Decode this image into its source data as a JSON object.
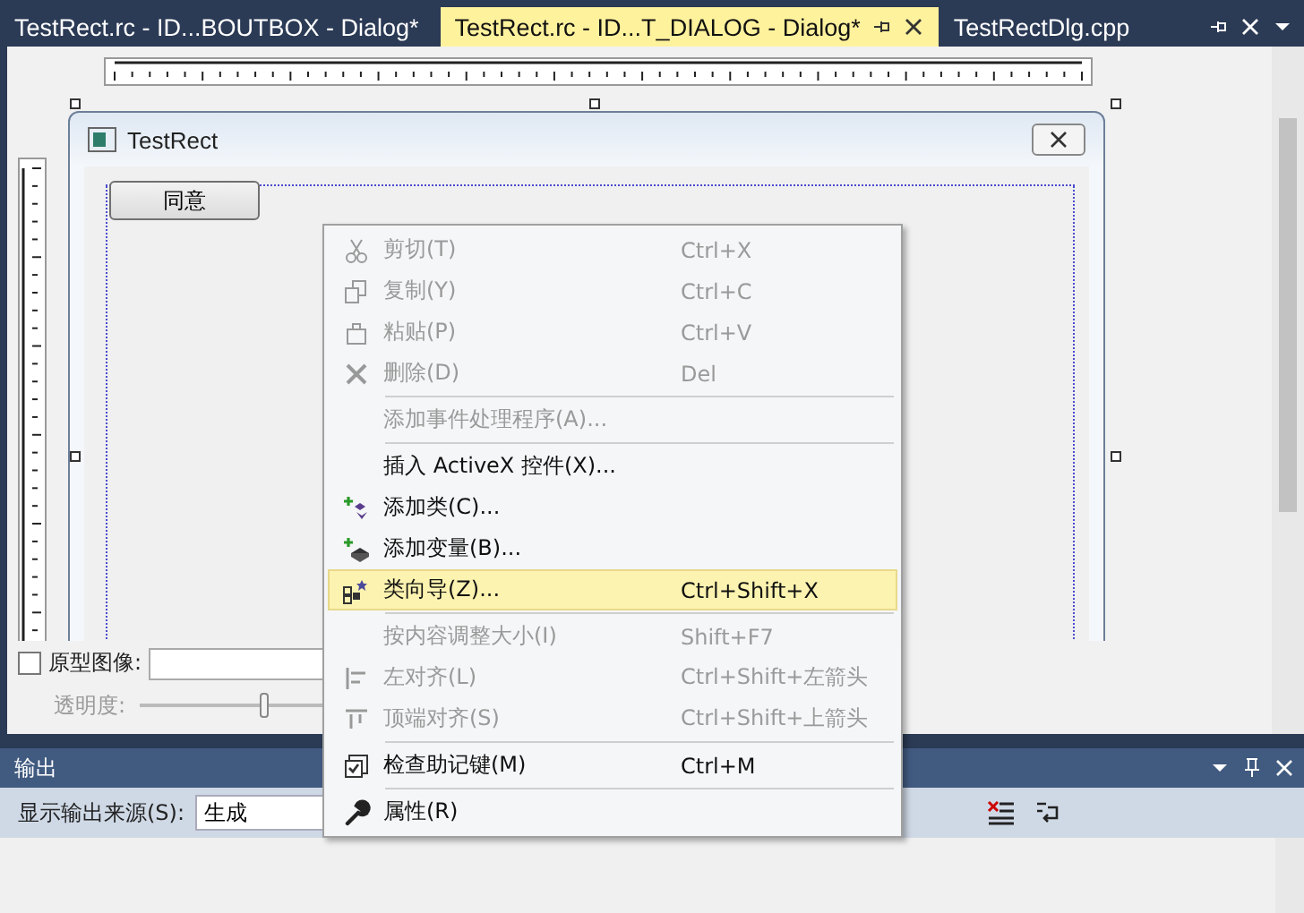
{
  "tabs": [
    {
      "label": "TestRect.rc - ID...BOUTBOX - Dialog*",
      "selected": false
    },
    {
      "label": "TestRect.rc - ID...T_DIALOG - Dialog*",
      "selected": true
    },
    {
      "label": "TestRectDlg.cpp",
      "selected": false
    }
  ],
  "dialog": {
    "title": "TestRect",
    "button": "同意"
  },
  "designer_options": {
    "prototype_checkbox": {
      "label": "原型图像:",
      "checked": false
    },
    "opacity": {
      "label": "透明度:",
      "level": 0.5
    }
  },
  "context_menu": [
    {
      "kind": "item",
      "label": "剪切(T)",
      "shortcut": "Ctrl+X",
      "disabled": true,
      "selected": false
    },
    {
      "kind": "item",
      "label": "复制(Y)",
      "shortcut": "Ctrl+C",
      "disabled": true,
      "selected": false
    },
    {
      "kind": "item",
      "label": "粘贴(P)",
      "shortcut": "Ctrl+V",
      "disabled": true,
      "selected": false
    },
    {
      "kind": "item",
      "label": "删除(D)",
      "shortcut": "Del",
      "disabled": true,
      "selected": false
    },
    {
      "kind": "separator"
    },
    {
      "kind": "item",
      "label": "添加事件处理程序(A)...",
      "disabled": true,
      "selected": false
    },
    {
      "kind": "separator"
    },
    {
      "kind": "item",
      "label": "插入 ActiveX 控件(X)...",
      "disabled": false,
      "selected": false
    },
    {
      "kind": "item",
      "label": "添加类(C)...",
      "disabled": false,
      "selected": false
    },
    {
      "kind": "item",
      "label": "添加变量(B)...",
      "disabled": false,
      "selected": false
    },
    {
      "kind": "item",
      "label": "类向导(Z)...",
      "shortcut": "Ctrl+Shift+X",
      "disabled": false,
      "selected": true
    },
    {
      "kind": "separator"
    },
    {
      "kind": "item",
      "label": "按内容调整大小(I)",
      "shortcut": "Shift+F7",
      "disabled": true,
      "selected": false
    },
    {
      "kind": "item",
      "label": "左对齐(L)",
      "shortcut": "Ctrl+Shift+左箭头",
      "disabled": true,
      "selected": false
    },
    {
      "kind": "item",
      "label": "顶端对齐(S)",
      "shortcut": "Ctrl+Shift+上箭头",
      "disabled": true,
      "selected": false
    },
    {
      "kind": "separator"
    },
    {
      "kind": "item",
      "label": "检查助记键(M)",
      "shortcut": "Ctrl+M",
      "disabled": false,
      "selected": false
    },
    {
      "kind": "separator"
    },
    {
      "kind": "item",
      "label": "属性(R)",
      "disabled": false,
      "selected": false
    }
  ],
  "output_panel": {
    "title": "输出",
    "source_label": "显示输出来源(S):",
    "source_value": "生成"
  }
}
